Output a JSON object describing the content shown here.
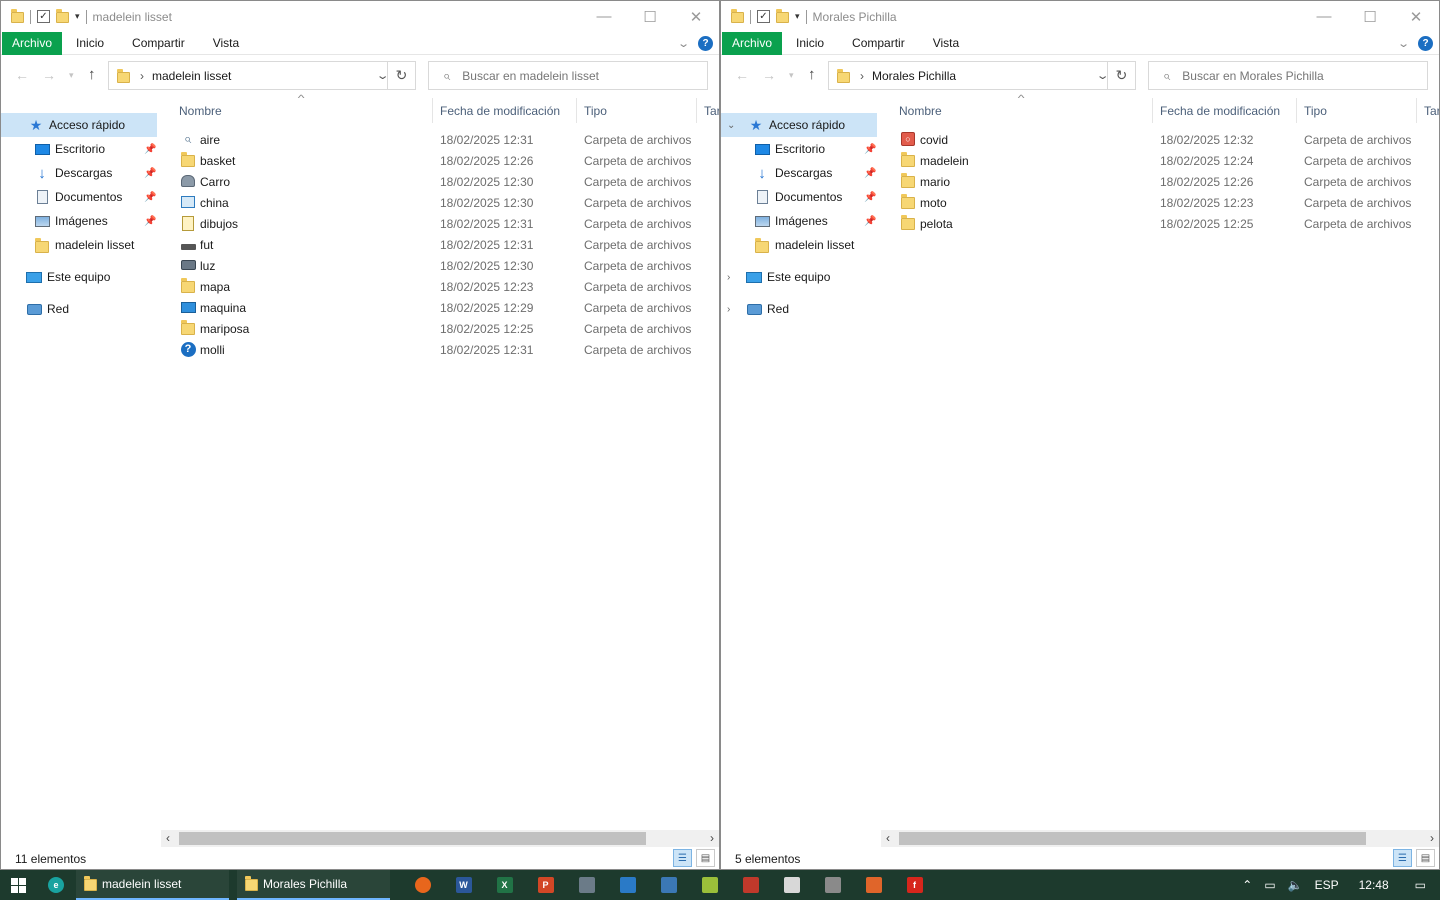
{
  "windows": {
    "left": {
      "title": "madelein lisset",
      "ribbon_tabs": [
        "Archivo",
        "Inicio",
        "Compartir",
        "Vista"
      ],
      "address": "madelein lisset",
      "search_placeholder": "Buscar en madelein lisset",
      "columns": {
        "name": "Nombre",
        "date": "Fecha de modificación",
        "type": "Tipo",
        "size": "Tar"
      },
      "files": [
        {
          "name": "aire",
          "date": "18/02/2025 12:31",
          "type": "Carpeta de archivos",
          "icon": "search-icon"
        },
        {
          "name": "basket",
          "date": "18/02/2025 12:26",
          "type": "Carpeta de archivos",
          "icon": "folder-icon"
        },
        {
          "name": "Carro",
          "date": "18/02/2025 12:30",
          "type": "Carpeta de archivos",
          "icon": "car-icon"
        },
        {
          "name": "china",
          "date": "18/02/2025 12:30",
          "type": "Carpeta de archivos",
          "icon": "network-icon"
        },
        {
          "name": "dibujos",
          "date": "18/02/2025 12:31",
          "type": "Carpeta de archivos",
          "icon": "document-icon"
        },
        {
          "name": "fut",
          "date": "18/02/2025 12:31",
          "type": "Carpeta de archivos",
          "icon": "drive-icon"
        },
        {
          "name": "luz",
          "date": "18/02/2025 12:30",
          "type": "Carpeta de archivos",
          "icon": "printer-icon"
        },
        {
          "name": "mapa",
          "date": "18/02/2025 12:23",
          "type": "Carpeta de archivos",
          "icon": "folder-icon"
        },
        {
          "name": "maquina",
          "date": "18/02/2025 12:29",
          "type": "Carpeta de archivos",
          "icon": "monitor-icon"
        },
        {
          "name": "mariposa",
          "date": "18/02/2025 12:25",
          "type": "Carpeta de archivos",
          "icon": "folder-icon"
        },
        {
          "name": "molli",
          "date": "18/02/2025 12:31",
          "type": "Carpeta de archivos",
          "icon": "help-icon"
        }
      ],
      "status": "11 elementos"
    },
    "right": {
      "title": "Morales Pichilla",
      "ribbon_tabs": [
        "Archivo",
        "Inicio",
        "Compartir",
        "Vista"
      ],
      "address": "Morales Pichilla",
      "search_placeholder": "Buscar en Morales Pichilla",
      "columns": {
        "name": "Nombre",
        "date": "Fecha de modificación",
        "type": "Tipo",
        "size": "Tar"
      },
      "files": [
        {
          "name": "covid",
          "date": "18/02/2025 12:32",
          "type": "Carpeta de archivos",
          "icon": "red-app-icon"
        },
        {
          "name": "madelein",
          "date": "18/02/2025 12:24",
          "type": "Carpeta de archivos",
          "icon": "folder-icon"
        },
        {
          "name": "mario",
          "date": "18/02/2025 12:26",
          "type": "Carpeta de archivos",
          "icon": "folder-icon"
        },
        {
          "name": "moto",
          "date": "18/02/2025 12:23",
          "type": "Carpeta de archivos",
          "icon": "folder-icon"
        },
        {
          "name": "pelota",
          "date": "18/02/2025 12:25",
          "type": "Carpeta de archivos",
          "icon": "folder-icon"
        }
      ],
      "status": "5 elementos"
    }
  },
  "nav": {
    "quick_access": "Acceso rápido",
    "desktop": "Escritorio",
    "downloads": "Descargas",
    "documents": "Documentos",
    "images": "Imágenes",
    "folder": "madelein lisset",
    "this_pc": "Este equipo",
    "network": "Red"
  },
  "taskbar": {
    "tasks": [
      "madelein lisset",
      "Morales Pichilla"
    ],
    "language": "ESP",
    "time": "12:48",
    "apps": [
      "edge-icon",
      "firefox-icon",
      "word-icon",
      "excel-icon",
      "powerpoint-icon",
      "app-icon",
      "app-icon",
      "app-icon",
      "app-icon",
      "app-icon",
      "app-icon",
      "app-icon",
      "app-icon",
      "app-icon"
    ]
  },
  "colors": {
    "accent": "#0aa14e",
    "selection": "#cce4f7",
    "taskbar": "#1d3a2d"
  }
}
